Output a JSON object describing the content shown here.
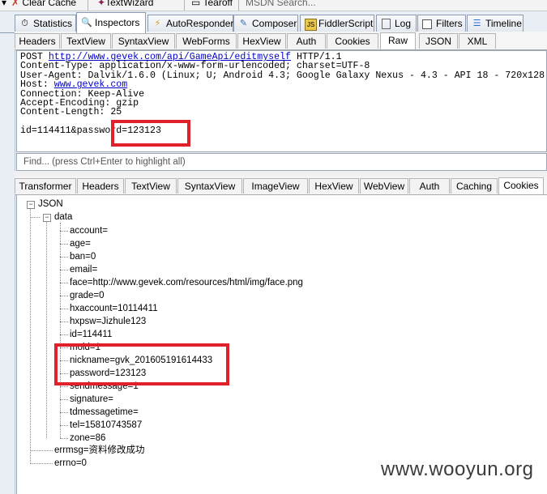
{
  "toolbar": {
    "items": [
      "Clear Cache",
      "TextWizard",
      "Tearoff",
      "MSDN Search..."
    ]
  },
  "main_tabs": [
    {
      "label": "Statistics",
      "icon": "stopwatch-icon"
    },
    {
      "label": "Inspectors",
      "icon": "magnifier-icon"
    },
    {
      "label": "AutoResponder",
      "icon": "lightning-icon"
    },
    {
      "label": "Composer",
      "icon": "pencil-icon"
    },
    {
      "label": "FiddlerScript",
      "icon": "script-icon"
    },
    {
      "label": "Log",
      "icon": "log-icon"
    },
    {
      "label": "Filters",
      "icon": "checkbox-icon"
    },
    {
      "label": "Timeline",
      "icon": "timeline-icon"
    }
  ],
  "request_tabs": [
    "Headers",
    "TextView",
    "SyntaxView",
    "WebForms",
    "HexView",
    "Auth",
    "Cookies",
    "Raw",
    "JSON",
    "XML"
  ],
  "request": {
    "method": "POST",
    "url": "http://www.gevek.com/api/GameApi/editmyself",
    "protocol": " HTTP/1.1",
    "content_type": "Content-Type: application/x-www-form-urlencoded; charset=UTF-8",
    "user_agent": "User-Agent: Dalvik/1.6.0 (Linux; U; Android 4.3; Google Galaxy Nexus - 4.3 - API 18 - 720x128",
    "host_label": "Host: ",
    "host": "www.gevek.com",
    "connection": "Connection: Keep-Alive",
    "accept_encoding": "Accept-Encoding: gzip",
    "content_length": "Content-Length: 25",
    "body": "id=114411&password=123123"
  },
  "find_placeholder": "Find... (press Ctrl+Enter to highlight all)",
  "response_tabs": [
    "Transformer",
    "Headers",
    "TextView",
    "SyntaxView",
    "ImageView",
    "HexView",
    "WebView",
    "Auth",
    "Caching",
    "Cookies"
  ],
  "json_tree": {
    "root": "JSON",
    "data_label": "data",
    "fields": [
      "account=",
      "age=",
      "ban=0",
      "email=",
      "face=http://www.gevek.com/resources/html/img/face.png",
      "grade=0",
      "hxaccount=10114411",
      "hxpsw=Jizhule123",
      "id=114411",
      "mold=1",
      "nickname=gvk_201605191614433",
      "password=123123",
      "sendmessage=1",
      "signature=",
      "tdmessagetime=",
      "tel=15810743587",
      "zone=86"
    ],
    "errmsg": "errmsg=资料修改成功",
    "errno": "errno=0"
  },
  "watermark": "www.wooyun.org",
  "colors": {
    "highlight": "#e0202a",
    "link": "#0000cc"
  }
}
